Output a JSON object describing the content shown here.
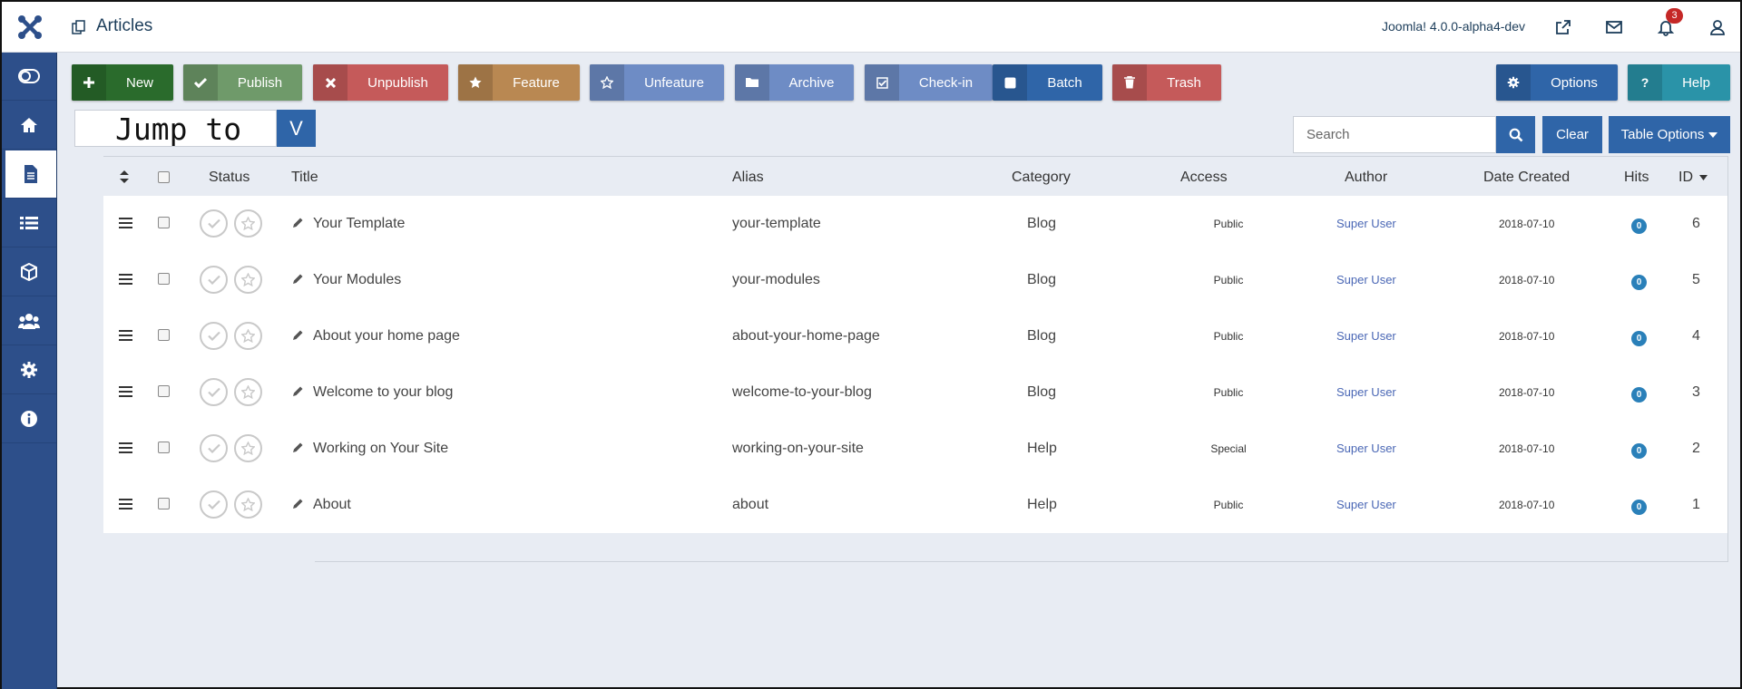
{
  "header": {
    "page_title": "Articles",
    "version": "Joomla! 4.0.0-alpha4-dev",
    "notification_count": "3"
  },
  "sidebar": {
    "items": [
      "toggle-icon",
      "home-icon",
      "articles-icon",
      "list-icon",
      "extensions-icon",
      "users-icon",
      "settings-icon",
      "info-icon"
    ]
  },
  "toolbar": {
    "new": "New",
    "publish": "Publish",
    "unpublish": "Unpublish",
    "feature": "Feature",
    "unfeature": "Unfeature",
    "archive": "Archive",
    "checkin": "Check-in",
    "batch": "Batch",
    "trash": "Trash",
    "options": "Options",
    "help": "Help"
  },
  "colors": {
    "new": "#2a6b2c",
    "publish": "#6f9a6a",
    "unpublish": "#c55a5a",
    "feature": "#b98852",
    "unfeature": "#6e8cc5",
    "archive": "#6e8cc5",
    "checkin": "#6e8cc5",
    "batch": "#2f65a8",
    "trash": "#c55a5a",
    "options": "#2f65a8",
    "help": "#2a93a8",
    "sidebar": "#2d4f8a"
  },
  "jump": {
    "label": "Jump to",
    "button": "V"
  },
  "search": {
    "placeholder": "Search",
    "clear": "Clear",
    "table_options": "Table Options"
  },
  "table": {
    "headers": {
      "status": "Status",
      "title": "Title",
      "alias": "Alias",
      "category": "Category",
      "access": "Access",
      "author": "Author",
      "date_created": "Date Created",
      "hits": "Hits",
      "id": "ID"
    },
    "rows": [
      {
        "title": "Your Template",
        "alias": "your-template",
        "category": "Blog",
        "access": "Public",
        "author": "Super User",
        "date": "2018-07-10",
        "hits": "0",
        "id": "6"
      },
      {
        "title": "Your Modules",
        "alias": "your-modules",
        "category": "Blog",
        "access": "Public",
        "author": "Super User",
        "date": "2018-07-10",
        "hits": "0",
        "id": "5"
      },
      {
        "title": "About your home page",
        "alias": "about-your-home-page",
        "category": "Blog",
        "access": "Public",
        "author": "Super User",
        "date": "2018-07-10",
        "hits": "0",
        "id": "4"
      },
      {
        "title": "Welcome to your blog",
        "alias": "welcome-to-your-blog",
        "category": "Blog",
        "access": "Public",
        "author": "Super User",
        "date": "2018-07-10",
        "hits": "0",
        "id": "3"
      },
      {
        "title": "Working on Your Site",
        "alias": "working-on-your-site",
        "category": "Help",
        "access": "Special",
        "author": "Super User",
        "date": "2018-07-10",
        "hits": "0",
        "id": "2"
      },
      {
        "title": "About",
        "alias": "about",
        "category": "Help",
        "access": "Public",
        "author": "Super User",
        "date": "2018-07-10",
        "hits": "0",
        "id": "1"
      }
    ]
  }
}
